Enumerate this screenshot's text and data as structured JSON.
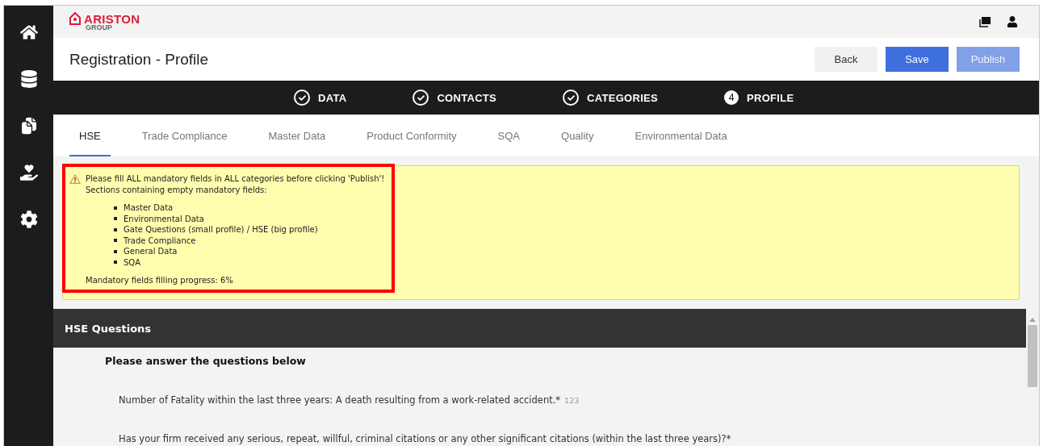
{
  "sidebar": {
    "items": [
      {
        "selected": false
      },
      {
        "selected": false
      },
      {
        "selected": false
      },
      {
        "selected": false
      },
      {
        "selected": false
      }
    ]
  },
  "header": {
    "logo": {
      "name": "ARISTON",
      "sub": "GROUP"
    }
  },
  "title": "Registration - Profile",
  "buttons": [
    {
      "label": "Back",
      "kind": "secondary",
      "disabled": false
    },
    {
      "label": "Save",
      "kind": "primary",
      "disabled": false
    },
    {
      "label": "Publish",
      "kind": "primary",
      "disabled": true
    }
  ],
  "steps": [
    {
      "label": "DATA",
      "kind": "done"
    },
    {
      "label": "CONTACTS",
      "kind": "done"
    },
    {
      "label": "CATEGORIES",
      "kind": "done"
    },
    {
      "label": "PROFILE",
      "kind": "current",
      "number": "4"
    }
  ],
  "tabs": [
    {
      "label": "HSE",
      "selected": true
    },
    {
      "label": "Trade Compliance",
      "selected": false
    },
    {
      "label": "Master Data",
      "selected": false
    },
    {
      "label": "Product Conformity",
      "selected": false
    },
    {
      "label": "SQA",
      "selected": false
    },
    {
      "label": "Quality",
      "selected": false
    },
    {
      "label": "Environmental Data",
      "selected": false
    }
  ],
  "notice": {
    "highlighted": true,
    "lines": [
      "Please fill ALL mandatory fields in ALL categories before clicking 'Publish'!",
      "Sections containing empty mandatory fields:"
    ],
    "sections": [
      "Master Data",
      "Environmental Data",
      "Gate Questions (small profile) / HSE (big profile)",
      "Trade Compliance",
      "General Data",
      "SQA"
    ],
    "progress": "Mandatory fields filling progress: 6%"
  },
  "panel": {
    "title": "HSE Questions",
    "intro": "Please answer the questions below",
    "questions": [
      {
        "text": "Number of Fatality within the last three years: A death resulting from a work-related accident.*",
        "placeholder": "123"
      },
      {
        "text": "Has your firm received any serious, repeat, willful, criminal citations or any other significant citations (within the last three years)?*"
      }
    ]
  }
}
